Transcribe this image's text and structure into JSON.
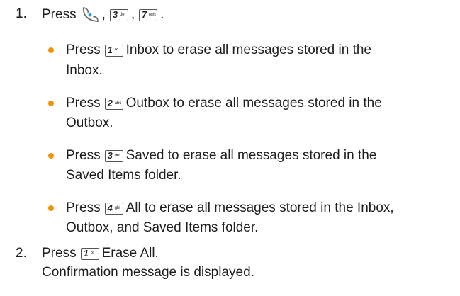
{
  "step1": {
    "number": "1.",
    "press": "Press",
    "comma1": ",",
    "comma2": ",",
    "period": ".",
    "keys": [
      {
        "name": "send-key",
        "icon": "send-key-icon"
      },
      {
        "digit": "3",
        "letters": "def"
      },
      {
        "digit": "7",
        "letters": "pqrs"
      }
    ]
  },
  "bullets": [
    {
      "press": "Press",
      "key_digit": "1",
      "key_letters": "∞",
      "line1": "Inbox to erase all messages stored in the",
      "line2": "Inbox."
    },
    {
      "press": "Press",
      "key_digit": "2",
      "key_letters": "abc",
      "line1": "Outbox to erase all messages stored in the",
      "line2": "Outbox."
    },
    {
      "press": "Press",
      "key_digit": "3",
      "key_letters": "def",
      "line1": "Saved to erase all messages stored in the",
      "line2": "Saved Items folder."
    },
    {
      "press": "Press",
      "key_digit": "4",
      "key_letters": "ghi",
      "line1": "All to erase all messages stored in the Inbox,",
      "line2": "Outbox, and Saved Items folder."
    }
  ],
  "step2": {
    "number": "2.",
    "press": "Press",
    "key_digit": "1",
    "key_letters": "∞",
    "action": "Erase All.",
    "result": "Confirmation message is displayed."
  },
  "colors": {
    "bullet": "#f29400",
    "text": "#1e1e1e",
    "send_key_accent": "#1aa0d8"
  }
}
